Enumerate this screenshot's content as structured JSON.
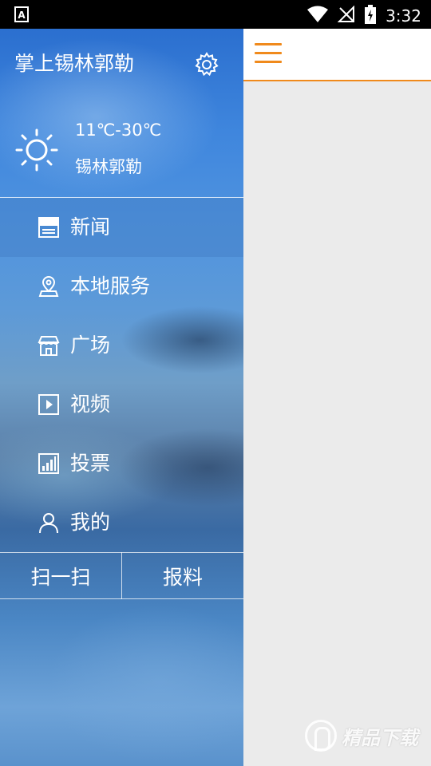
{
  "status_bar": {
    "time": "3:32",
    "icons": [
      "accessibility-icon",
      "wifi-icon",
      "no-signal-icon",
      "battery-charging-icon"
    ]
  },
  "drawer": {
    "app_title": "掌上锡林郭勒",
    "settings_icon": "gear-icon",
    "weather": {
      "icon": "sun-icon",
      "temperature": "11℃-30℃",
      "city": "锡林郭勒"
    },
    "menu": [
      {
        "label": "新闻",
        "icon": "newspaper-icon",
        "active": true
      },
      {
        "label": "本地服务",
        "icon": "location-pin-icon",
        "active": false
      },
      {
        "label": "广场",
        "icon": "storefront-icon",
        "active": false
      },
      {
        "label": "视频",
        "icon": "play-box-icon",
        "active": false
      },
      {
        "label": "投票",
        "icon": "bar-chart-icon",
        "active": false
      },
      {
        "label": "我的",
        "icon": "person-icon",
        "active": false
      }
    ],
    "actions": {
      "scan": "扫一扫",
      "report": "报料"
    }
  },
  "main": {
    "menu_icon": "hamburger-icon",
    "accent_color": "#f08a1c"
  },
  "watermark": {
    "text": "精品下载"
  }
}
